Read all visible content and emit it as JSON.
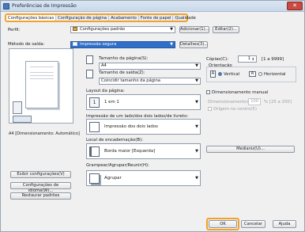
{
  "window": {
    "title": "Preferências de Impressão",
    "close_glyph": "✕"
  },
  "tabs": [
    {
      "label": "Configurações básicas",
      "active": true
    },
    {
      "label": "Configuração de página",
      "active": false
    },
    {
      "label": "Acabamento",
      "active": false
    },
    {
      "label": "Fonte de papel",
      "active": false
    },
    {
      "label": "Qualidade",
      "active": false
    }
  ],
  "profile": {
    "label": "Perfil:",
    "value": "Configurações padrão",
    "add_button": "Adicionar(1)...",
    "edit_button": "Editar(2)..."
  },
  "output_method": {
    "label": "Método de saída:",
    "value": "Impressão segura",
    "details_button": "Detalhes(3)..."
  },
  "preview": {
    "caption": "A4 [Dimensionamento: Automático]"
  },
  "left_buttons": {
    "view_settings": "Exibir configurações(V)",
    "language_settings": "Configurações de idioma(W)...",
    "restore_defaults": "Restaurar padrões"
  },
  "page_size": {
    "label": "Tamanho da página(S):",
    "value": "A4"
  },
  "output_size": {
    "label": "Tamanho de saída(Z):",
    "value": "Coincidir tamanho da página"
  },
  "copies": {
    "label": "Cópias(C):",
    "value": "1",
    "range": "[1 a 9999]"
  },
  "orientation": {
    "label": "Orientação",
    "vertical": "Vertical",
    "horizontal": "Horizontal",
    "selected": "vertical"
  },
  "layout": {
    "label": "Layout da página:",
    "value": "1 em 1",
    "icon_text": "1"
  },
  "manual_scaling": {
    "label": "Dimensionamento manual",
    "scaling_label": "Dimensionamento(E):",
    "scaling_value": "100",
    "scaling_range": "% [25 a 200]",
    "center_origin": "Origem no centro(5)"
  },
  "duplex": {
    "label": "Impressão de um lado/dos dois lados/de livreto:",
    "value": "Impressão dos dois lados"
  },
  "binding": {
    "label": "Local de encadernação(B):",
    "value": "Borda maior [Esquerda]",
    "margin_button": "Medianiz(U)..."
  },
  "staple": {
    "label": "Grampear/Agrupar/Reunir(H):",
    "value": "Agrupar"
  },
  "footer": {
    "ok": "OK",
    "cancel": "Cancelar",
    "apply": "Aplicar",
    "help": "Ajuda"
  },
  "colors": {
    "highlight": "#f2a22a",
    "accent": "#2f6fc9"
  }
}
